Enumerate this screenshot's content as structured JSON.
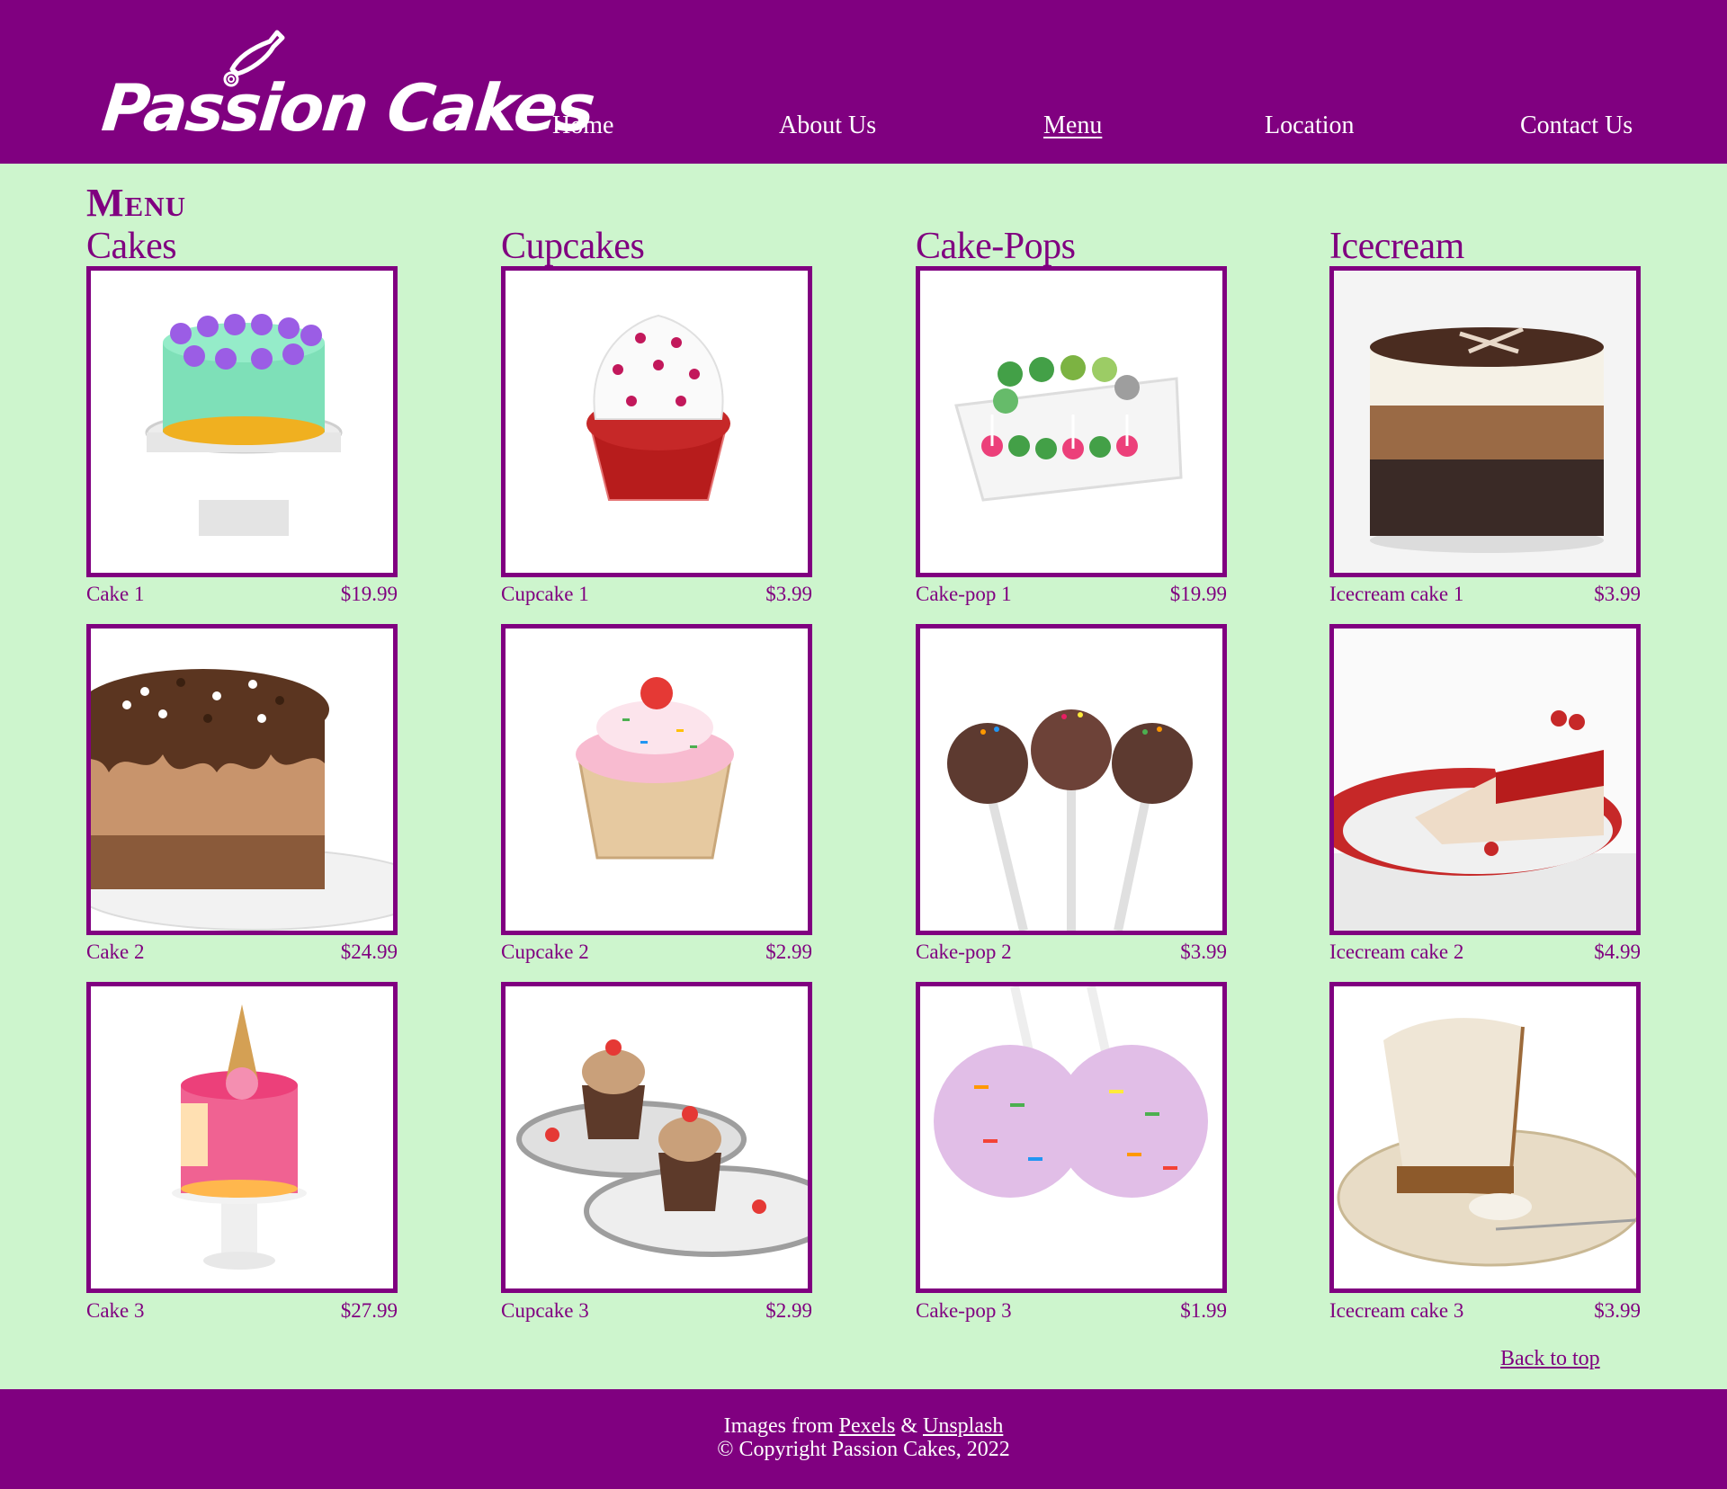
{
  "brand": {
    "name": "Passion Cakes",
    "primary_color": "#800080",
    "background_color": "#cdf5cd"
  },
  "nav": {
    "items": [
      {
        "label": "Home"
      },
      {
        "label": "About Us"
      },
      {
        "label": "Menu",
        "active": true
      },
      {
        "label": "Location"
      },
      {
        "label": "Contact Us"
      }
    ]
  },
  "main": {
    "title": "Menu",
    "columns": [
      {
        "heading": "Cakes",
        "items": [
          {
            "name": "Cake 1",
            "price": "$19.99",
            "image": "cake-image"
          },
          {
            "name": "Cake 2",
            "price": "$24.99",
            "image": "cake-image"
          },
          {
            "name": "Cake 3",
            "price": "$27.99",
            "image": "cake-image"
          }
        ]
      },
      {
        "heading": "Cupcakes",
        "items": [
          {
            "name": "Cupcake 1",
            "price": "$3.99",
            "image": "cupcake-image"
          },
          {
            "name": "Cupcake 2",
            "price": "$2.99",
            "image": "cupcake-image"
          },
          {
            "name": "Cupcake 3",
            "price": "$2.99",
            "image": "cupcake-image"
          }
        ]
      },
      {
        "heading": "Cake-Pops",
        "items": [
          {
            "name": "Cake-pop 1",
            "price": "$19.99",
            "image": "cake-pop-image"
          },
          {
            "name": "Cake-pop 2",
            "price": "$3.99",
            "image": "cake-pop-image"
          },
          {
            "name": "Cake-pop 3",
            "price": "$1.99",
            "image": "cake-pop-image"
          }
        ]
      },
      {
        "heading": "Icecream",
        "items": [
          {
            "name": "Icecream cake 1",
            "price": "$3.99",
            "image": "icecream-cake-image"
          },
          {
            "name": "Icecream cake 2",
            "price": "$4.99",
            "image": "icecream-cake-image"
          },
          {
            "name": "Icecream cake 3",
            "price": "$3.99",
            "image": "icecream-cake-image"
          }
        ]
      }
    ],
    "back_to_top": "Back to top"
  },
  "footer": {
    "images_from": "Images from",
    "pexels": "Pexels",
    "amp": "&",
    "unsplash": "Unsplash",
    "copyright": "© Copyright Passion Cakes, 2022"
  }
}
